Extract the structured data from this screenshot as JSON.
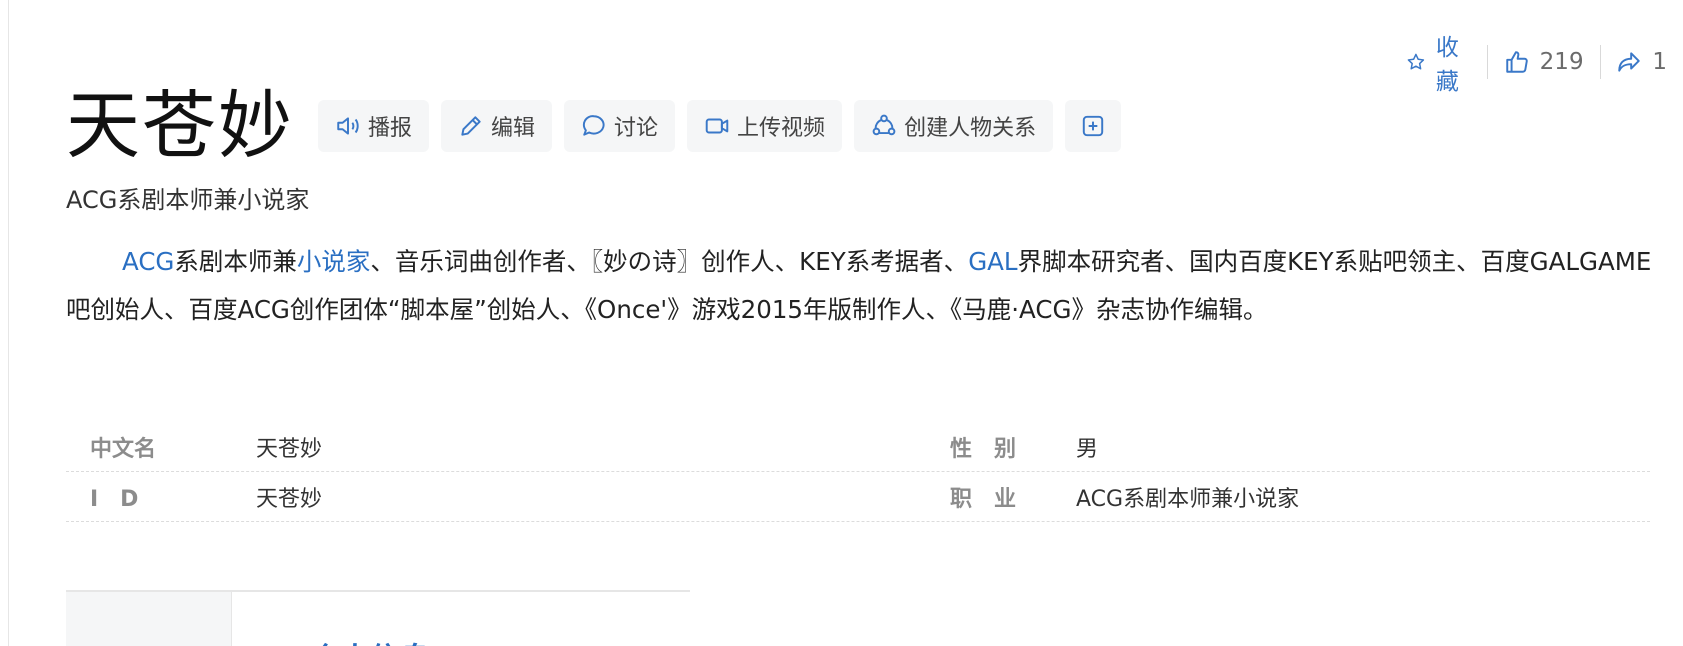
{
  "actions": {
    "favorite": {
      "label": "收藏",
      "icon": "star-icon"
    },
    "like": {
      "count": "219",
      "icon": "thumbs-up-icon"
    },
    "share": {
      "count": "1",
      "icon": "share-icon"
    }
  },
  "entry": {
    "title": "天苍妙",
    "subtitle": "ACG系剧本师兼小说家"
  },
  "toolbar": [
    {
      "label": "播报",
      "icon": "speaker-icon"
    },
    {
      "label": "编辑",
      "icon": "pencil-icon"
    },
    {
      "label": "讨论",
      "icon": "chat-icon"
    },
    {
      "label": "上传视频",
      "icon": "video-camera-icon"
    },
    {
      "label": "创建人物关系",
      "icon": "relationship-icon"
    },
    {
      "label": "",
      "icon": "plus-square-icon"
    }
  ],
  "summary": {
    "link1": "ACG",
    "text1": "系剧本师兼",
    "link2": "小说家",
    "text2": "、音乐词曲创作者、〖妙の诗〗创作人、KEY系考据者、",
    "link3": "GAL",
    "text3": "界脚本研究者、国内百度KEY系贴吧领主、百度GALGAME吧创始人、百度ACG创作团体“脚本屋”创始人、《Once'》游戏2015年版制作人、《马鹿·ACG》杂志协作编辑。"
  },
  "infobox": [
    {
      "k1": "中文名",
      "v1": "天苍妙",
      "k2": "性　别",
      "v2": "男"
    },
    {
      "k1": "I　D",
      "v1": "天苍妙",
      "k2": "职　业",
      "v2": "ACG系剧本师兼小说家"
    }
  ],
  "catalog": {
    "heading": "个人信息",
    "icon": "chevron-icon"
  },
  "colors": {
    "link": "#2a6fc2",
    "accent": "#3a78c8",
    "button_bg": "#f5f6f7"
  }
}
